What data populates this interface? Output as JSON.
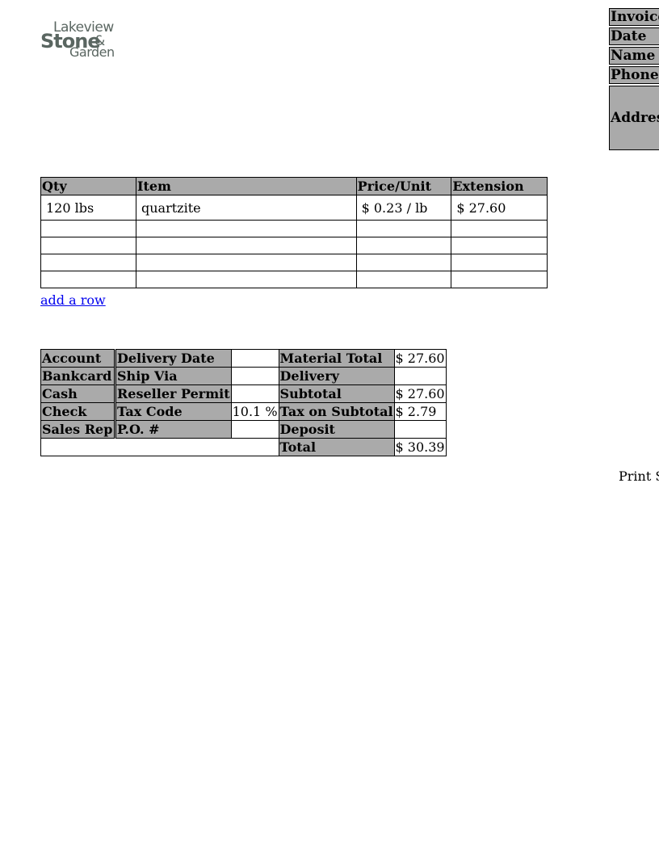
{
  "logo": {
    "line1": "Lakeview",
    "line2": "Stone",
    "amp": "&",
    "line3": "Garden"
  },
  "header_fields": [
    "Invoice",
    "Date",
    "Name",
    "Phone",
    "Addres"
  ],
  "items_table": {
    "headers": [
      "Qty",
      "Item",
      "Price/Unit",
      "Extension"
    ],
    "rows": [
      {
        "qty": "120 lbs",
        "item": "quartzite",
        "price": "$ 0.23 / lb",
        "extension": "$ 27.60"
      },
      {
        "qty": "",
        "item": "",
        "price": "",
        "extension": ""
      },
      {
        "qty": "",
        "item": "",
        "price": "",
        "extension": ""
      },
      {
        "qty": "",
        "item": "",
        "price": "",
        "extension": ""
      },
      {
        "qty": "",
        "item": "",
        "price": "",
        "extension": ""
      }
    ]
  },
  "add_row_label": "add a row",
  "payment": {
    "account": "Account",
    "bankcard": "Bankcard",
    "cash": "Cash",
    "check": "Check",
    "sales_rep": "Sales Rep"
  },
  "order": {
    "delivery_date": "Delivery Date",
    "ship_via": "Ship Via",
    "reseller_permit": "Reseller Permit",
    "tax_code": "Tax Code",
    "tax_code_value": "10.1 %",
    "po": "P.O. #"
  },
  "totals": {
    "material_total_label": "Material Total",
    "material_total_value": "$ 27.60",
    "delivery_label": "Delivery",
    "delivery_value": "",
    "subtotal_label": "Subtotal",
    "subtotal_value": "$ 27.60",
    "tax_label": "Tax on Subtotal",
    "tax_value": "$ 2.79",
    "deposit_label": "Deposit",
    "deposit_value": "",
    "total_label": "Total",
    "total_value": "$ 30.39"
  },
  "print_label": "Print S"
}
